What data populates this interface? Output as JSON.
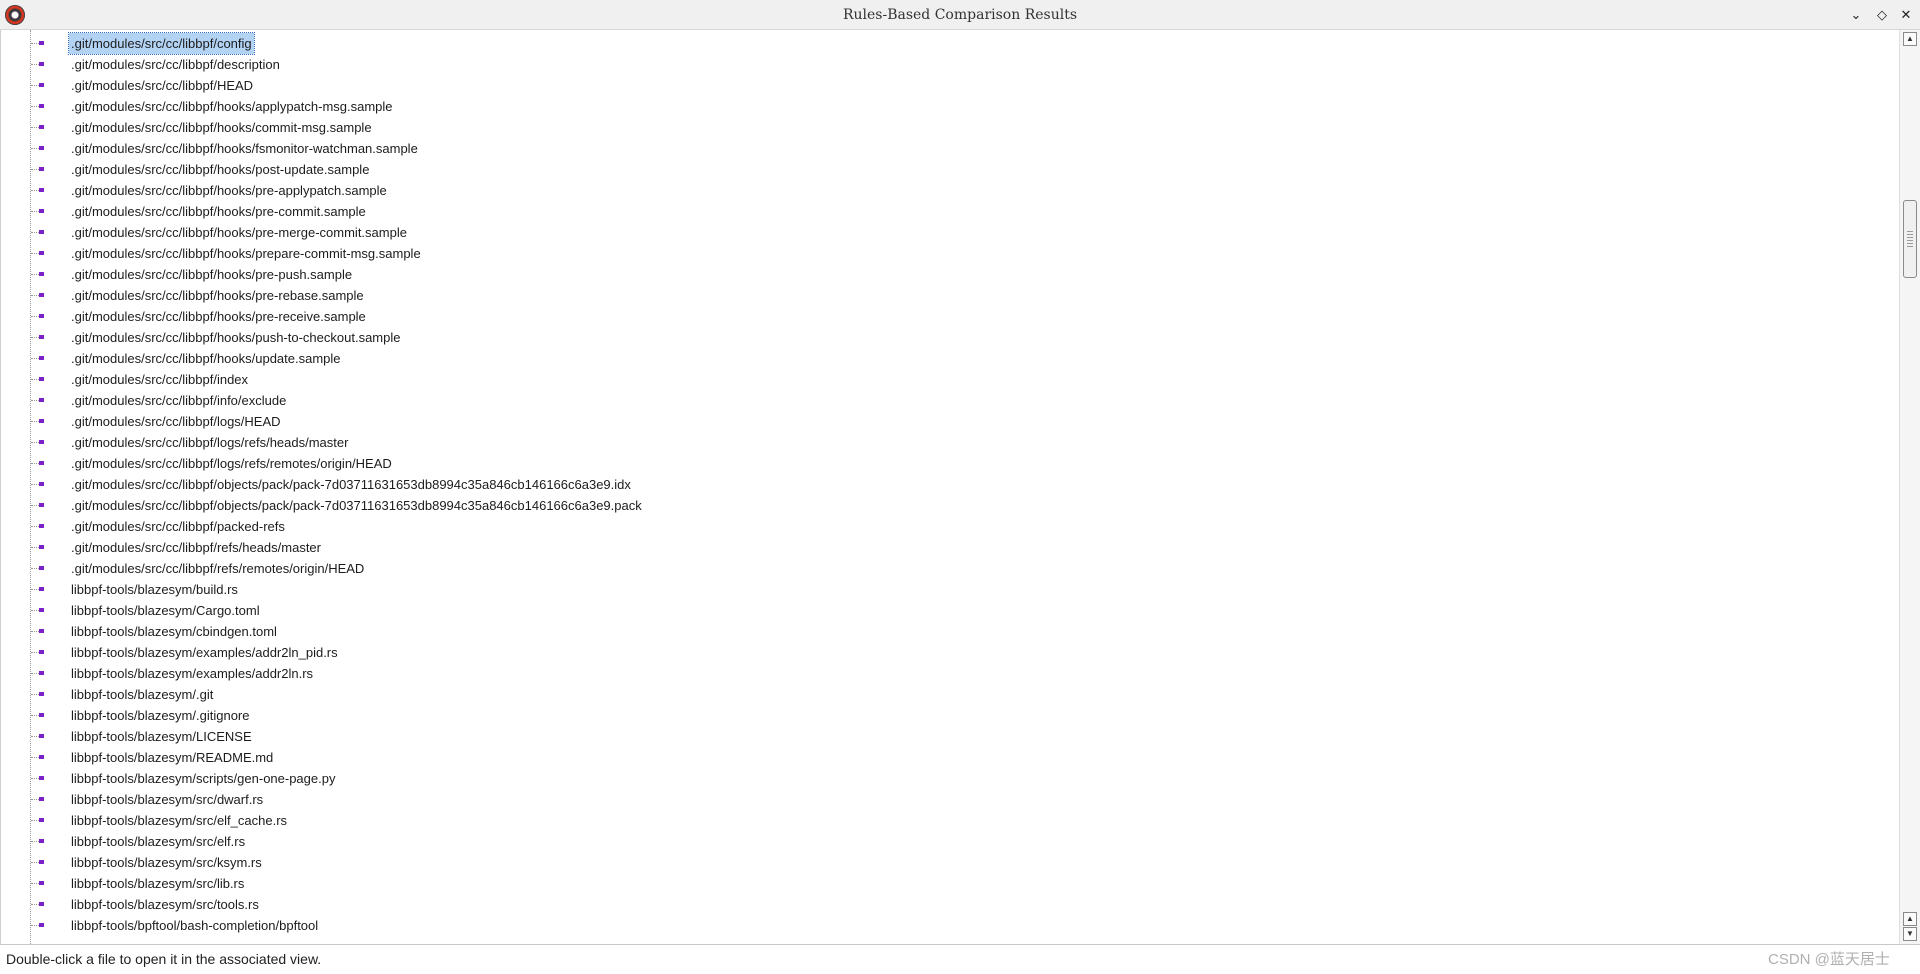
{
  "window": {
    "title": "Rules-Based Comparison Results",
    "icon": "eclipse-app-icon",
    "controls": [
      "chevron-down-icon",
      "restore-icon",
      "close-icon"
    ],
    "marker_color": "#7a22c8",
    "selection_color": "#b3d3f5"
  },
  "files": [
    ".git/modules/src/cc/libbpf/config",
    ".git/modules/src/cc/libbpf/description",
    ".git/modules/src/cc/libbpf/HEAD",
    ".git/modules/src/cc/libbpf/hooks/applypatch-msg.sample",
    ".git/modules/src/cc/libbpf/hooks/commit-msg.sample",
    ".git/modules/src/cc/libbpf/hooks/fsmonitor-watchman.sample",
    ".git/modules/src/cc/libbpf/hooks/post-update.sample",
    ".git/modules/src/cc/libbpf/hooks/pre-applypatch.sample",
    ".git/modules/src/cc/libbpf/hooks/pre-commit.sample",
    ".git/modules/src/cc/libbpf/hooks/pre-merge-commit.sample",
    ".git/modules/src/cc/libbpf/hooks/prepare-commit-msg.sample",
    ".git/modules/src/cc/libbpf/hooks/pre-push.sample",
    ".git/modules/src/cc/libbpf/hooks/pre-rebase.sample",
    ".git/modules/src/cc/libbpf/hooks/pre-receive.sample",
    ".git/modules/src/cc/libbpf/hooks/push-to-checkout.sample",
    ".git/modules/src/cc/libbpf/hooks/update.sample",
    ".git/modules/src/cc/libbpf/index",
    ".git/modules/src/cc/libbpf/info/exclude",
    ".git/modules/src/cc/libbpf/logs/HEAD",
    ".git/modules/src/cc/libbpf/logs/refs/heads/master",
    ".git/modules/src/cc/libbpf/logs/refs/remotes/origin/HEAD",
    ".git/modules/src/cc/libbpf/objects/pack/pack-7d03711631653db8994c35a846cb146166c6a3e9.idx",
    ".git/modules/src/cc/libbpf/objects/pack/pack-7d03711631653db8994c35a846cb146166c6a3e9.pack",
    ".git/modules/src/cc/libbpf/packed-refs",
    ".git/modules/src/cc/libbpf/refs/heads/master",
    ".git/modules/src/cc/libbpf/refs/remotes/origin/HEAD",
    "libbpf-tools/blazesym/build.rs",
    "libbpf-tools/blazesym/Cargo.toml",
    "libbpf-tools/blazesym/cbindgen.toml",
    "libbpf-tools/blazesym/examples/addr2ln_pid.rs",
    "libbpf-tools/blazesym/examples/addr2ln.rs",
    "libbpf-tools/blazesym/.git",
    "libbpf-tools/blazesym/.gitignore",
    "libbpf-tools/blazesym/LICENSE",
    "libbpf-tools/blazesym/README.md",
    "libbpf-tools/blazesym/scripts/gen-one-page.py",
    "libbpf-tools/blazesym/src/dwarf.rs",
    "libbpf-tools/blazesym/src/elf_cache.rs",
    "libbpf-tools/blazesym/src/elf.rs",
    "libbpf-tools/blazesym/src/ksym.rs",
    "libbpf-tools/blazesym/src/lib.rs",
    "libbpf-tools/blazesym/src/tools.rs",
    "libbpf-tools/bpftool/bash-completion/bpftool"
  ],
  "status": {
    "text": "Double-click a file to open it in the associated view.",
    "watermark": "CSDN @蓝天居士"
  }
}
